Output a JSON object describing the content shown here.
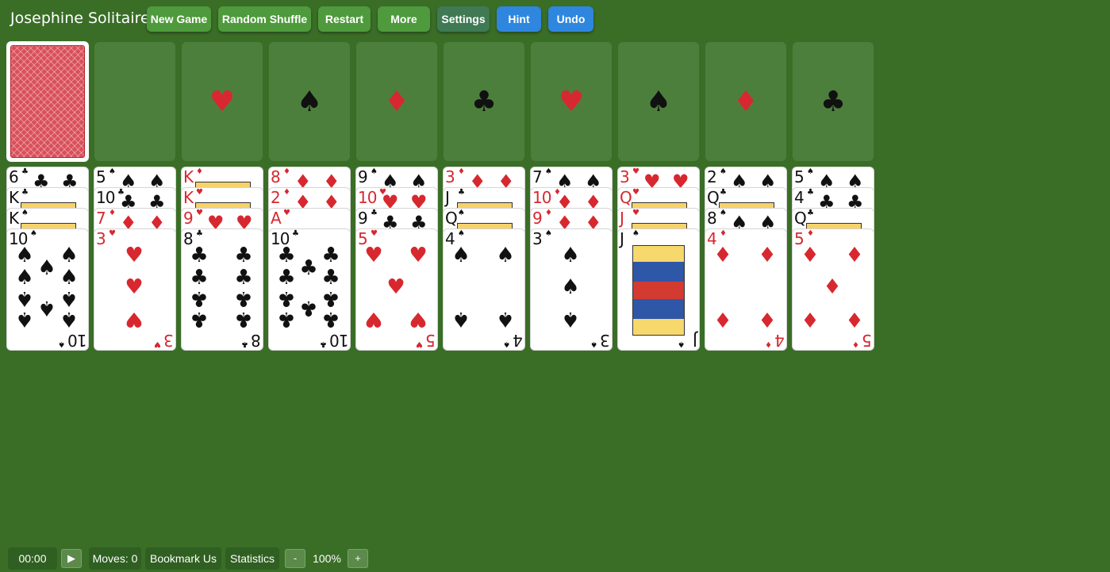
{
  "app": {
    "title": "Josephine Solitaire"
  },
  "toolbar": {
    "new_game": "New Game",
    "random_shuffle": "Random Shuffle",
    "restart": "Restart",
    "more": "More",
    "settings": "Settings",
    "hint": "Hint",
    "undo": "Undo"
  },
  "foundations": [
    "♥",
    "♠",
    "♦",
    "♣",
    "♥",
    "♠",
    "♦",
    "♣"
  ],
  "tableau": [
    {
      "cards": [
        {
          "rank": "6",
          "suit": "♣",
          "color": "black"
        },
        {
          "rank": "K",
          "suit": "♣",
          "color": "black"
        },
        {
          "rank": "K",
          "suit": "♠",
          "color": "black"
        },
        {
          "rank": "10",
          "suit": "♠",
          "color": "black"
        }
      ]
    },
    {
      "cards": [
        {
          "rank": "5",
          "suit": "♠",
          "color": "black"
        },
        {
          "rank": "10",
          "suit": "♣",
          "color": "black"
        },
        {
          "rank": "7",
          "suit": "♦",
          "color": "red"
        },
        {
          "rank": "3",
          "suit": "♥",
          "color": "red"
        }
      ]
    },
    {
      "cards": [
        {
          "rank": "K",
          "suit": "♦",
          "color": "red"
        },
        {
          "rank": "K",
          "suit": "♥",
          "color": "red"
        },
        {
          "rank": "9",
          "suit": "♥",
          "color": "red"
        },
        {
          "rank": "8",
          "suit": "♣",
          "color": "black"
        }
      ]
    },
    {
      "cards": [
        {
          "rank": "8",
          "suit": "♦",
          "color": "red"
        },
        {
          "rank": "2",
          "suit": "♦",
          "color": "red"
        },
        {
          "rank": "A",
          "suit": "♥",
          "color": "red"
        },
        {
          "rank": "10",
          "suit": "♣",
          "color": "black"
        }
      ]
    },
    {
      "cards": [
        {
          "rank": "9",
          "suit": "♠",
          "color": "black"
        },
        {
          "rank": "10",
          "suit": "♥",
          "color": "red"
        },
        {
          "rank": "9",
          "suit": "♣",
          "color": "black"
        },
        {
          "rank": "5",
          "suit": "♥",
          "color": "red"
        }
      ]
    },
    {
      "cards": [
        {
          "rank": "3",
          "suit": "♦",
          "color": "red"
        },
        {
          "rank": "J",
          "suit": "♣",
          "color": "black"
        },
        {
          "rank": "Q",
          "suit": "♠",
          "color": "black"
        },
        {
          "rank": "4",
          "suit": "♠",
          "color": "black"
        }
      ]
    },
    {
      "cards": [
        {
          "rank": "7",
          "suit": "♠",
          "color": "black"
        },
        {
          "rank": "10",
          "suit": "♦",
          "color": "red"
        },
        {
          "rank": "9",
          "suit": "♦",
          "color": "red"
        },
        {
          "rank": "3",
          "suit": "♠",
          "color": "black"
        }
      ]
    },
    {
      "cards": [
        {
          "rank": "3",
          "suit": "♥",
          "color": "red"
        },
        {
          "rank": "Q",
          "suit": "♥",
          "color": "red"
        },
        {
          "rank": "J",
          "suit": "♥",
          "color": "red"
        },
        {
          "rank": "J",
          "suit": "♠",
          "color": "black"
        }
      ]
    },
    {
      "cards": [
        {
          "rank": "2",
          "suit": "♠",
          "color": "black"
        },
        {
          "rank": "Q",
          "suit": "♣",
          "color": "black"
        },
        {
          "rank": "8",
          "suit": "♠",
          "color": "black"
        },
        {
          "rank": "4",
          "suit": "♦",
          "color": "red"
        }
      ]
    },
    {
      "cards": [
        {
          "rank": "5",
          "suit": "♠",
          "color": "black"
        },
        {
          "rank": "4",
          "suit": "♣",
          "color": "black"
        },
        {
          "rank": "Q",
          "suit": "♣",
          "color": "black"
        },
        {
          "rank": "5",
          "suit": "♦",
          "color": "red"
        }
      ]
    }
  ],
  "status": {
    "timer": "00:00",
    "play_icon": "▶",
    "moves": "Moves: 0",
    "bookmark": "Bookmark Us",
    "statistics": "Statistics",
    "zoom_out": "-",
    "zoom": "100%",
    "zoom_in": "+"
  },
  "colors": {
    "felt": "#3a6e27",
    "red_suit": "#d7282f",
    "button_green": "#4f9a3c",
    "button_blue": "#2f86de"
  }
}
